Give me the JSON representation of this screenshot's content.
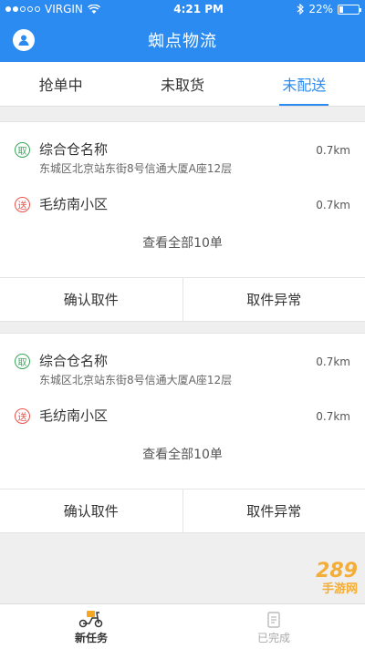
{
  "status_bar": {
    "carrier": "VIRGIN",
    "time": "4:21 PM",
    "battery": "22%",
    "battery_level": 0.22
  },
  "header": {
    "title": "蜘点物流"
  },
  "tabs": [
    {
      "label": "抢单中"
    },
    {
      "label": "未取货"
    },
    {
      "label": "未配送"
    }
  ],
  "orders": [
    {
      "pickup": {
        "badge": "取",
        "name": "综合仓名称",
        "address": "东城区北京站东街8号信通大厦A座12层",
        "distance": "0.7km"
      },
      "delivery": {
        "badge": "送",
        "name": "毛纺南小区",
        "distance": "0.7km"
      },
      "view_all": "查看全部10单",
      "confirm_label": "确认取件",
      "exception_label": "取件异常"
    },
    {
      "pickup": {
        "badge": "取",
        "name": "综合仓名称",
        "address": "东城区北京站东街8号信通大厦A座12层",
        "distance": "0.7km"
      },
      "delivery": {
        "badge": "送",
        "name": "毛纺南小区",
        "distance": "0.7km"
      },
      "view_all": "查看全部10单",
      "confirm_label": "确认取件",
      "exception_label": "取件异常"
    }
  ],
  "bottom_tabs": [
    {
      "label": "新任务"
    },
    {
      "label": "已完成"
    }
  ],
  "watermark": {
    "text": "289",
    "sub": "手游网"
  },
  "colors": {
    "primary": "#2b8bf0",
    "pickup": "#3aa55c",
    "delivery": "#e9534d"
  }
}
